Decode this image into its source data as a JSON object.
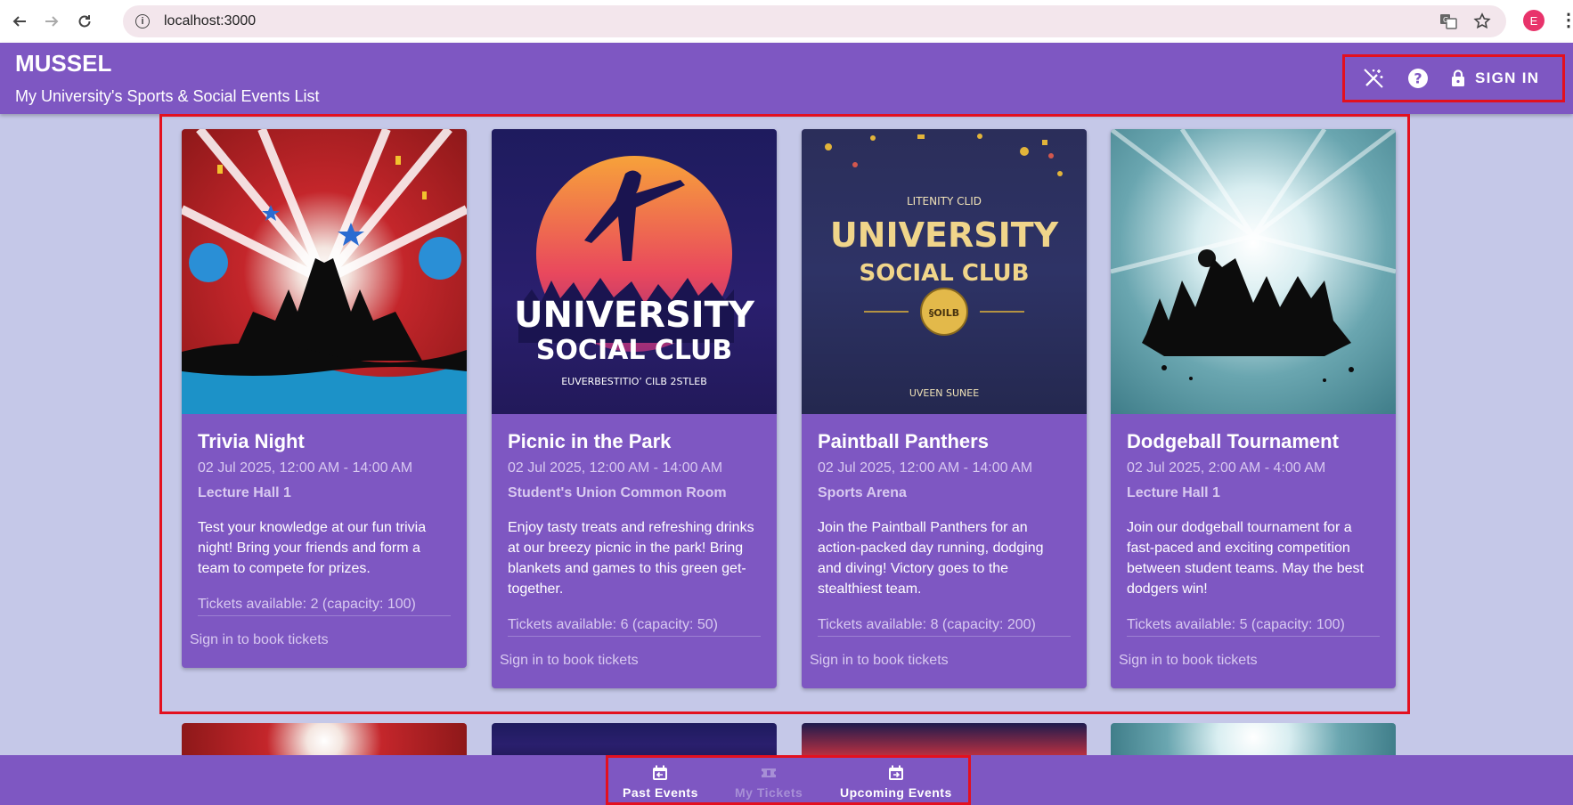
{
  "browser": {
    "url": "localhost:3000",
    "profile_initial": "E"
  },
  "app": {
    "title": "MUSSEL",
    "subtitle": "My University's Sports & Social Events List",
    "actions": {
      "theme_icon": "magic-wand-off-icon",
      "help_icon": "help-circle-icon",
      "lock_icon": "lock-icon",
      "sign_in_label": "SIGN IN"
    }
  },
  "events": [
    {
      "title": "Trivia Night",
      "date": "02 Jul 2025, 12:00 AM - 14:00 AM",
      "venue": "Lecture Hall 1",
      "description": "Test your knowledge at our fun trivia night! Bring your friends and form a team to compete for prizes.",
      "tickets": "Tickets available: 2 (capacity: 100)",
      "action": "Sign in to book tickets",
      "image_text": []
    },
    {
      "title": "Picnic in the Park",
      "date": "02 Jul 2025, 12:00 AM - 14:00 AM",
      "venue": "Student's Union Common Room",
      "description": "Enjoy tasty treats and refreshing drinks at our breezy picnic in the park! Bring blankets and games to this green get-together.",
      "tickets": "Tickets available: 6 (capacity: 50)",
      "action": "Sign in to book tickets",
      "image_text": [
        "UNIVERSITY",
        "SOCIAL CLUB",
        "EUVERBESTITIO’ CILB 2STLEB"
      ]
    },
    {
      "title": "Paintball Panthers",
      "date": "02 Jul 2025, 12:00 AM - 14:00 AM",
      "venue": "Sports Arena",
      "description": "Join the Paintball Panthers for an action-packed day running, dodging and diving! Victory goes to the stealthiest team.",
      "tickets": "Tickets available: 8 (capacity: 200)",
      "action": "Sign in to book tickets",
      "image_text": [
        "LITENITY CLID",
        "UNIVERSITY",
        "SOCIAL CLUB",
        "§OILB",
        "UVEEN SUNEE"
      ]
    },
    {
      "title": "Dodgeball Tournament",
      "date": "02 Jul 2025, 2:00 AM - 4:00 AM",
      "venue": "Lecture Hall 1",
      "description": "Join our dodgeball tournament for a fast-paced and exciting competition between student teams. May the best dodgers win!",
      "tickets": "Tickets available: 5 (capacity: 100)",
      "action": "Sign in to book tickets",
      "image_text": []
    }
  ],
  "bottom_nav": [
    {
      "label": "Past Events",
      "icon": "calendar-arrow-left-icon",
      "enabled": true
    },
    {
      "label": "My Tickets",
      "icon": "ticket-icon",
      "enabled": false
    },
    {
      "label": "Upcoming Events",
      "icon": "calendar-arrow-right-icon",
      "enabled": true
    }
  ],
  "colors": {
    "primary": "#7e57c2",
    "background": "#c5c8e8",
    "highlight": "#e3101f",
    "muted_text": "#d8c9f0"
  }
}
